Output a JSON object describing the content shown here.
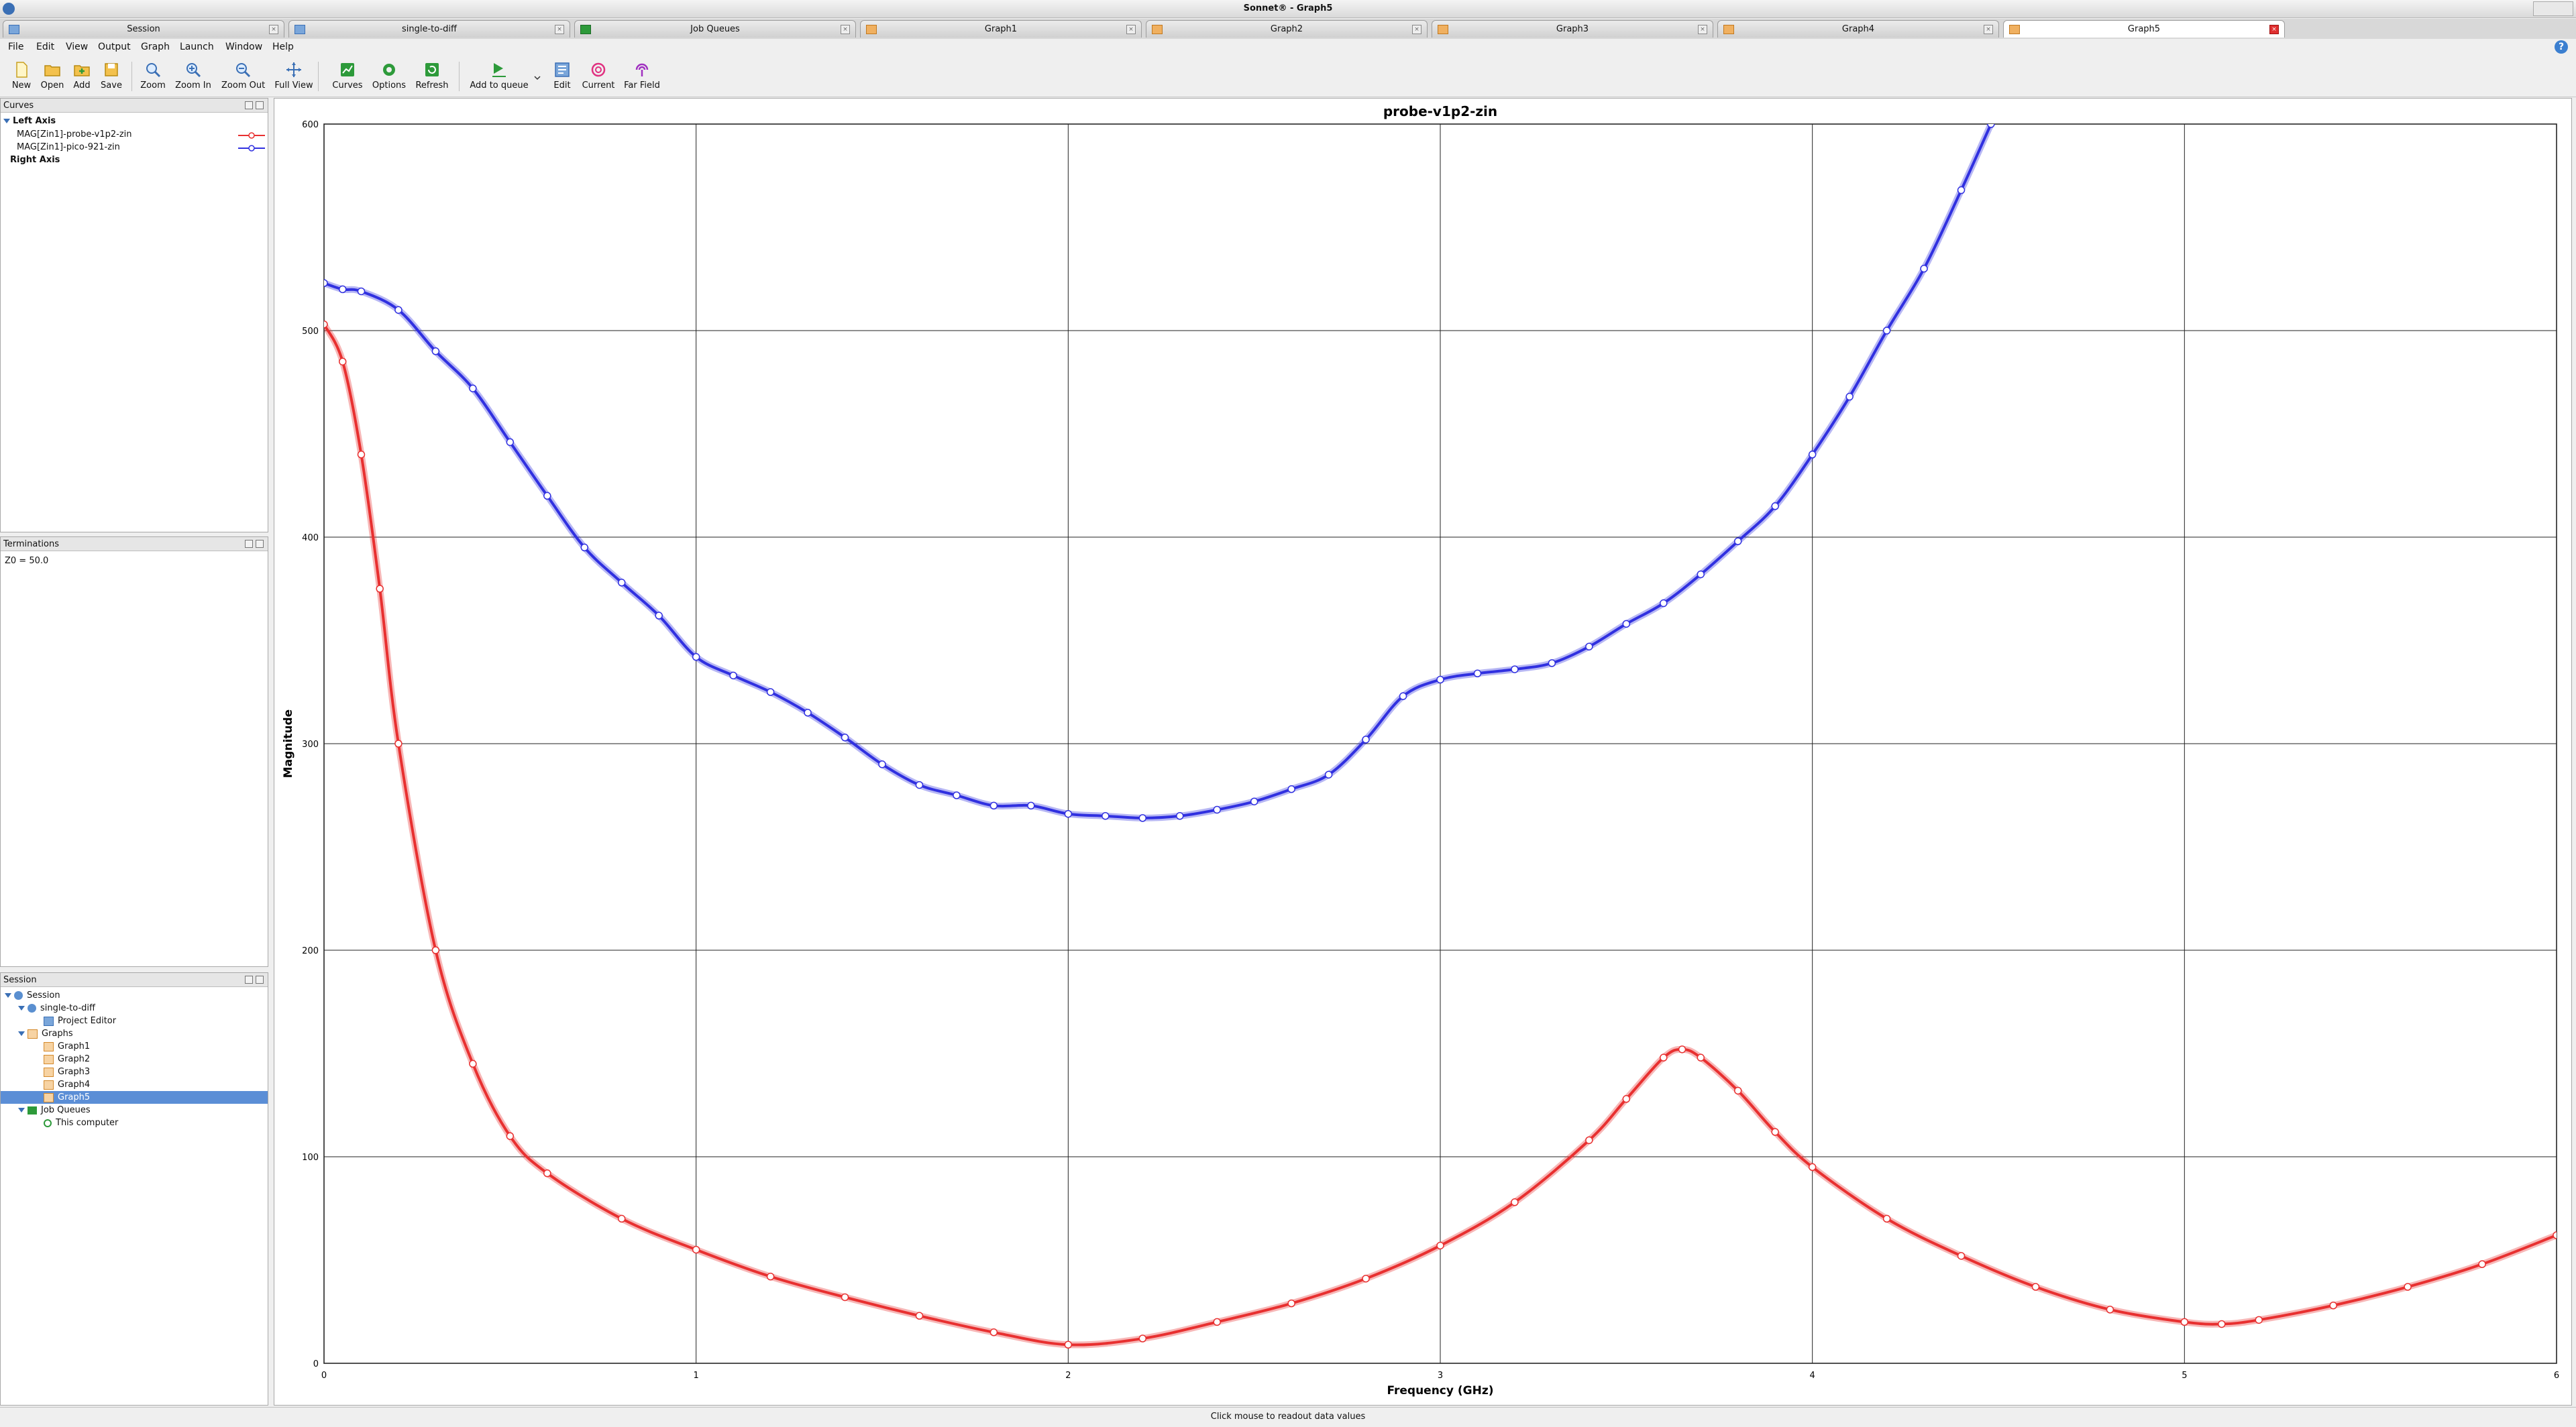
{
  "window": {
    "title": "Sonnet® - Graph5"
  },
  "tabs": [
    {
      "label": "Session",
      "active": false
    },
    {
      "label": "single-to-diff",
      "active": false
    },
    {
      "label": "Job Queues",
      "active": false
    },
    {
      "label": "Graph1",
      "active": false
    },
    {
      "label": "Graph2",
      "active": false
    },
    {
      "label": "Graph3",
      "active": false
    },
    {
      "label": "Graph4",
      "active": false
    },
    {
      "label": "Graph5",
      "active": true
    }
  ],
  "menu": [
    "File",
    "Edit",
    "View",
    "Output",
    "Graph",
    "Launch",
    "Window",
    "Help"
  ],
  "toolbar": {
    "new": "New",
    "open": "Open",
    "add": "Add",
    "save": "Save",
    "zoom": "Zoom",
    "zoom_in": "Zoom In",
    "zoom_out": "Zoom Out",
    "full_view": "Full View",
    "curves": "Curves",
    "options": "Options",
    "refresh": "Refresh",
    "add_to_queue": "Add to queue",
    "edit": "Edit",
    "current": "Current",
    "far_field": "Far Field"
  },
  "curves_panel": {
    "title": "Curves",
    "left_axis": "Left Axis",
    "right_axis": "Right Axis",
    "items": [
      {
        "label": "MAG[Zin1]-probe-v1p2-zin",
        "color": "#e83030"
      },
      {
        "label": "MAG[Zin1]-pico-921-zin",
        "color": "#3030e0"
      }
    ]
  },
  "terminations_panel": {
    "title": "Terminations",
    "z0": "Z0 = 50.0"
  },
  "session_panel": {
    "title": "Session",
    "root": "Session",
    "project": "single-to-diff",
    "project_editor": "Project Editor",
    "graphs": "Graphs",
    "graph_items": [
      "Graph1",
      "Graph2",
      "Graph3",
      "Graph4",
      "Graph5"
    ],
    "job_queues": "Job Queues",
    "this_computer": "This computer"
  },
  "status": {
    "text": "Click mouse to readout data values"
  },
  "chart_data": {
    "type": "line",
    "title": "probe-v1p2-zin",
    "xlabel": "Frequency (GHz)",
    "ylabel": "Magnitude",
    "xlim": [
      0,
      6
    ],
    "ylim": [
      0,
      600
    ],
    "xticks": [
      "0",
      "1",
      "2",
      "3",
      "4",
      "5",
      "6"
    ],
    "yticks": [
      "0",
      "100",
      "200",
      "300",
      "400",
      "500",
      "600"
    ],
    "grid": true,
    "series": [
      {
        "name": "MAG[Zin1]-probe-v1p2-zin",
        "color": "#e83030",
        "x": [
          0,
          0.05,
          0.1,
          0.15,
          0.2,
          0.3,
          0.4,
          0.5,
          0.6,
          0.8,
          1.0,
          1.2,
          1.4,
          1.6,
          1.8,
          2.0,
          2.2,
          2.4,
          2.6,
          2.8,
          3.0,
          3.2,
          3.4,
          3.5,
          3.6,
          3.65,
          3.7,
          3.8,
          3.9,
          4.0,
          4.2,
          4.4,
          4.6,
          4.8,
          5.0,
          5.1,
          5.2,
          5.4,
          5.6,
          5.8,
          6.0
        ],
        "y": [
          503,
          485,
          440,
          375,
          300,
          200,
          145,
          110,
          92,
          70,
          55,
          42,
          32,
          23,
          15,
          9,
          12,
          20,
          29,
          41,
          57,
          78,
          108,
          128,
          148,
          152,
          148,
          132,
          112,
          95,
          70,
          52,
          37,
          26,
          20,
          19,
          21,
          28,
          37,
          48,
          62
        ]
      },
      {
        "name": "MAG[Zin1]-pico-921-zin",
        "color": "#3030e0",
        "x": [
          0,
          0.05,
          0.1,
          0.2,
          0.3,
          0.4,
          0.5,
          0.6,
          0.7,
          0.8,
          0.9,
          1.0,
          1.1,
          1.2,
          1.3,
          1.4,
          1.5,
          1.6,
          1.7,
          1.8,
          1.9,
          2.0,
          2.1,
          2.2,
          2.3,
          2.4,
          2.5,
          2.6,
          2.7,
          2.8,
          2.9,
          3.0,
          3.1,
          3.2,
          3.3,
          3.4,
          3.5,
          3.6,
          3.7,
          3.8,
          3.9,
          4.0,
          4.1,
          4.2,
          4.3,
          4.4,
          4.48
        ],
        "y": [
          523,
          520,
          519,
          510,
          490,
          472,
          446,
          420,
          395,
          378,
          362,
          342,
          333,
          325,
          315,
          303,
          290,
          280,
          275,
          270,
          270,
          266,
          265,
          264,
          265,
          268,
          272,
          278,
          285,
          302,
          323,
          331,
          334,
          336,
          339,
          347,
          358,
          368,
          382,
          398,
          415,
          440,
          468,
          500,
          530,
          568,
          600
        ]
      }
    ]
  }
}
